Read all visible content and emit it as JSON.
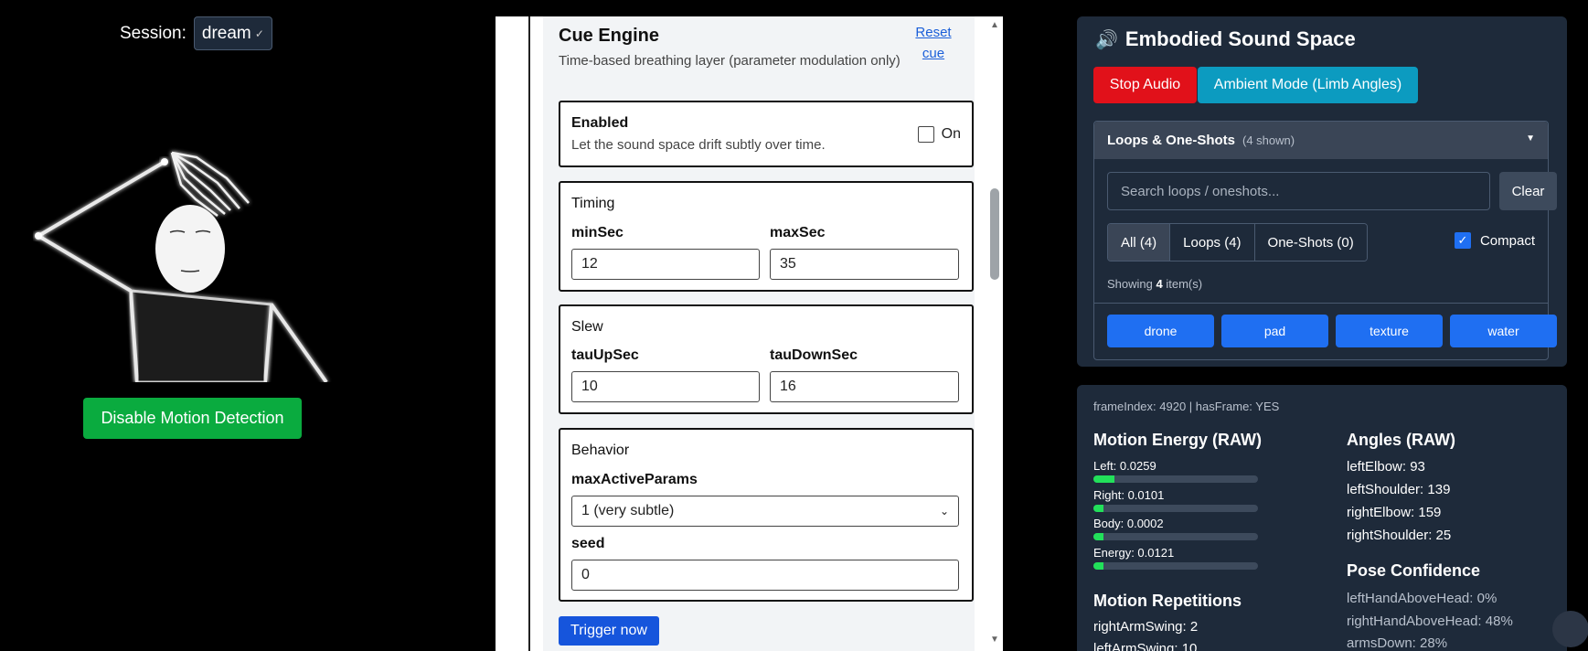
{
  "session": {
    "label": "Session:",
    "value": "dream"
  },
  "left": {
    "motion_button": "Disable Motion Detection"
  },
  "cue_engine": {
    "title": "Cue Engine",
    "subtitle": "Time-based breathing layer (parameter modulation only)",
    "reset_link": "Reset cue",
    "enabled": {
      "title": "Enabled",
      "description": "Let the sound space drift subtly over time.",
      "checkbox_label": "On",
      "checked": false
    },
    "timing": {
      "title": "Timing",
      "min_label": "minSec",
      "min_value": "12",
      "max_label": "maxSec",
      "max_value": "35"
    },
    "slew": {
      "title": "Slew",
      "up_label": "tauUpSec",
      "up_value": "10",
      "down_label": "tauDownSec",
      "down_value": "16"
    },
    "behavior": {
      "title": "Behavior",
      "max_label": "maxActiveParams",
      "max_value": "1 (very subtle)",
      "seed_label": "seed",
      "seed_value": "0"
    },
    "trigger_button": "Trigger now"
  },
  "sound_space": {
    "title": "Embodied Sound Space",
    "icon": "speaker-icon",
    "stop_button": "Stop Audio",
    "ambient_button": "Ambient Mode (Limb Angles)",
    "loops": {
      "header": "Loops & One-Shots",
      "count": "(4 shown)",
      "search_placeholder": "Search loops / oneshots...",
      "clear_button": "Clear",
      "filters": [
        "All (4)",
        "Loops (4)",
        "One-Shots (0)"
      ],
      "active_filter": "All (4)",
      "compact_label": "Compact",
      "compact_checked": true,
      "showing_prefix": "Showing",
      "showing_count": "4",
      "showing_suffix": "item(s)",
      "items": [
        "drone",
        "pad",
        "texture",
        "water"
      ]
    }
  },
  "stats": {
    "frame_info": "frameIndex: 4920 | hasFrame: YES",
    "motion_energy": {
      "title": "Motion Energy (RAW)",
      "left": "Left: 0.0259",
      "left_level": 0.0259,
      "right": "Right: 0.0101",
      "right_level": 0.0101,
      "body": "Body: 0.0002",
      "body_level": 0.0002,
      "energy": "Energy: 0.0121",
      "energy_level": 0.0121
    },
    "angles": {
      "title": "Angles (RAW)",
      "left_elbow": "leftElbow: 93",
      "left_shoulder": "leftShoulder: 139",
      "right_elbow": "rightElbow: 159",
      "right_shoulder": "rightShoulder: 25"
    },
    "pose_confidence": {
      "title": "Pose Confidence",
      "left_hand": "leftHandAboveHead: 0%",
      "right_hand": "rightHandAboveHead: 48%",
      "arms_down": "armsDown: 28%"
    },
    "repetitions": {
      "title": "Motion Repetitions",
      "right_arm": "rightArmSwing: 2",
      "left_arm": "leftArmSwing: 10"
    }
  }
}
